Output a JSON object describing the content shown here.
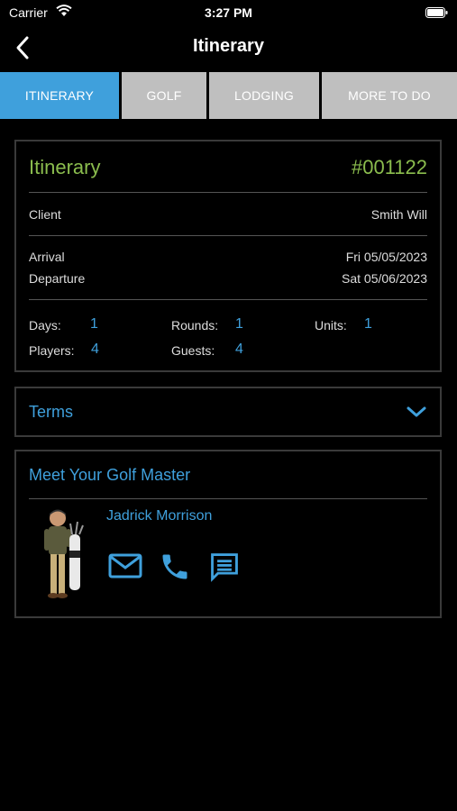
{
  "status": {
    "carrier": "Carrier",
    "time": "3:27 PM"
  },
  "nav": {
    "title": "Itinerary"
  },
  "tabs": [
    {
      "label": "ITINERARY"
    },
    {
      "label": "GOLF"
    },
    {
      "label": "LODGING"
    },
    {
      "label": "MORE TO DO"
    }
  ],
  "itinerary": {
    "title": "Itinerary",
    "number": "#001122",
    "client_label": "Client",
    "client_value": "Smith Will",
    "arrival_label": "Arrival",
    "arrival_value": "Fri 05/05/2023",
    "departure_label": "Departure",
    "departure_value": "Sat 05/06/2023",
    "days_label": "Days:",
    "days_value": "1",
    "rounds_label": "Rounds:",
    "rounds_value": "1",
    "units_label": "Units:",
    "units_value": "1",
    "players_label": "Players:",
    "players_value": "4",
    "guests_label": "Guests:",
    "guests_value": "4"
  },
  "terms": {
    "label": "Terms"
  },
  "golf_master": {
    "heading": "Meet Your Golf Master",
    "name": "Jadrick Morrison"
  },
  "colors": {
    "accent": "#3fa0dc",
    "green": "#8bbd4e",
    "tab_inactive": "#bfbfbf"
  }
}
